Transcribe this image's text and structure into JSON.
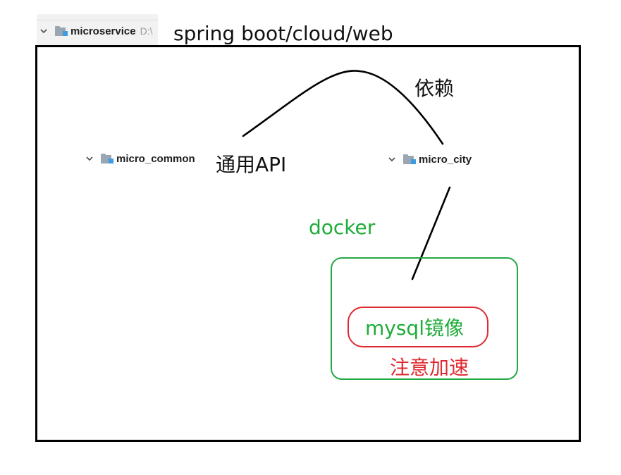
{
  "title": "spring boot/cloud/web",
  "root_node": {
    "label": "microservice",
    "path": "D:\\"
  },
  "modules": {
    "common": {
      "label": "micro_common",
      "annotation": "通用API"
    },
    "city": {
      "label": "micro_city"
    }
  },
  "dependency_label": "依赖",
  "docker": {
    "label": "docker",
    "image_label": "mysql镜像",
    "note": "注意加速"
  },
  "colors": {
    "frame": "#000000",
    "docker": "#1fac3a",
    "mysql_outline": "#e02a31",
    "note": "#e02a31",
    "folder": "#9aa7b3",
    "folder_badge": "#3b9ce0"
  },
  "icons": [
    "chevron-down-icon",
    "module-folder-icon"
  ]
}
